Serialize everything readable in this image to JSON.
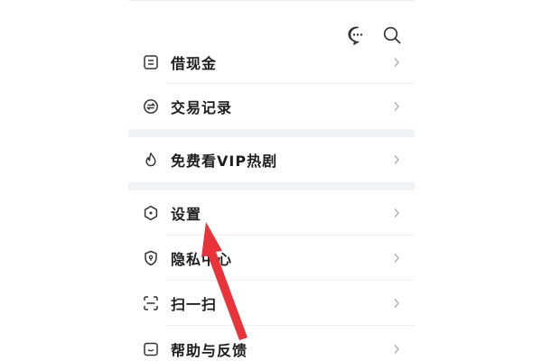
{
  "header": {
    "icons": [
      "message-icon",
      "search-icon"
    ]
  },
  "menu": {
    "items": [
      {
        "label": "借现金",
        "icon": "card-icon"
      },
      {
        "label": "交易记录",
        "icon": "exchange-icon"
      },
      {
        "label": "免费看VIP热剧",
        "icon": "flame-icon"
      },
      {
        "label": "设置",
        "icon": "settings-icon"
      },
      {
        "label": "隐私中心",
        "icon": "shield-icon"
      },
      {
        "label": "扫一扫",
        "icon": "scan-icon"
      },
      {
        "label": "帮助与反馈",
        "icon": "feedback-icon"
      }
    ]
  },
  "colors": {
    "arrow": "#e8333b",
    "section_gap": "#f2f3f7",
    "text": "#1e1e1e",
    "icon": "#333333",
    "chevron": "#b0b0b0"
  }
}
